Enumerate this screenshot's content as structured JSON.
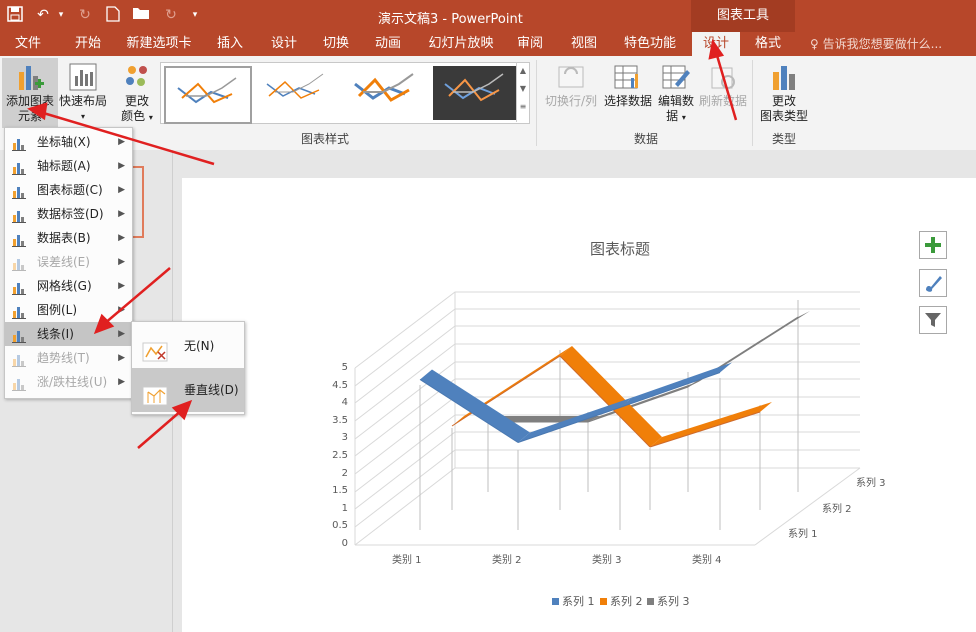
{
  "titlebar": {
    "document_title": "演示文稿3 - PowerPoint",
    "context_tab_group": "图表工具"
  },
  "tabs": [
    {
      "label": "文件"
    },
    {
      "label": "开始"
    },
    {
      "label": "新建选项卡"
    },
    {
      "label": "插入"
    },
    {
      "label": "设计"
    },
    {
      "label": "切换"
    },
    {
      "label": "动画"
    },
    {
      "label": "幻灯片放映"
    },
    {
      "label": "审阅"
    },
    {
      "label": "视图"
    },
    {
      "label": "特色功能"
    },
    {
      "label": "设计"
    },
    {
      "label": "格式"
    }
  ],
  "active_tab_index": 11,
  "tell_me": "告诉我您想要做什么...",
  "ribbon": {
    "add_element_line1": "添加图表",
    "add_element_line2": "元素",
    "quick_layout": "快速布局",
    "change_colors_line1": "更改",
    "change_colors_line2": "颜色",
    "group_chart_styles": "图表样式",
    "switch_row_col": "切换行/列",
    "select_data": "选择数据",
    "edit_data_line1": "编辑数",
    "edit_data_line2": "据",
    "refresh_data": "刷新数据",
    "group_data": "数据",
    "change_type_line1": "更改",
    "change_type_line2": "图表类型",
    "group_type": "类型"
  },
  "menu": {
    "items": [
      {
        "label": "坐标轴(X)",
        "icon": "axis-icon",
        "disabled": false,
        "submenu": true
      },
      {
        "label": "轴标题(A)",
        "icon": "axis-title-icon",
        "disabled": false,
        "submenu": true
      },
      {
        "label": "图表标题(C)",
        "icon": "chart-title-icon",
        "disabled": false,
        "submenu": true
      },
      {
        "label": "数据标签(D)",
        "icon": "data-label-icon",
        "disabled": false,
        "submenu": true
      },
      {
        "label": "数据表(B)",
        "icon": "data-table-icon",
        "disabled": false,
        "submenu": true
      },
      {
        "label": "误差线(E)",
        "icon": "error-bar-icon",
        "disabled": true,
        "submenu": true
      },
      {
        "label": "网格线(G)",
        "icon": "gridlines-icon",
        "disabled": false,
        "submenu": true
      },
      {
        "label": "图例(L)",
        "icon": "legend-icon",
        "disabled": false,
        "submenu": true
      },
      {
        "label": "线条(I)",
        "icon": "lines-icon",
        "disabled": false,
        "submenu": true,
        "hover": true
      },
      {
        "label": "趋势线(T)",
        "icon": "trendline-icon",
        "disabled": true,
        "submenu": true
      },
      {
        "label": "涨/跌柱线(U)",
        "icon": "updown-bars-icon",
        "disabled": true,
        "submenu": true
      }
    ]
  },
  "submenu": {
    "none_label": "无(N)",
    "drop_lines_label": "垂直线(D)"
  },
  "chart": {
    "title": "图表标题",
    "y_ticks": [
      "0",
      "0.5",
      "1",
      "1.5",
      "2",
      "2.5",
      "3",
      "3.5",
      "4",
      "4.5",
      "5"
    ],
    "x_ticks": [
      "类别 1",
      "类别 2",
      "类别 3",
      "类别 4"
    ],
    "z_ticks": [
      "系列 1",
      "系列 2",
      "系列 3"
    ],
    "legend": [
      "系列 1",
      "系列 2",
      "系列 3"
    ],
    "colors": {
      "s1": "#4f81bd",
      "s2": "#f07f09",
      "s3": "#7f7f7f",
      "s1_dark": "#4a78b0",
      "s2_dark": "#cd6a2c"
    }
  },
  "chart_data": {
    "type": "line",
    "title": "图表标题",
    "categories": [
      "类别 1",
      "类别 2",
      "类别 3",
      "类别 4"
    ],
    "series": [
      {
        "name": "系列 1",
        "values": [
          4.3,
          2.5,
          3.5,
          4.5
        ]
      },
      {
        "name": "系列 2",
        "values": [
          2.4,
          4.4,
          1.8,
          2.8
        ]
      },
      {
        "name": "系列 3",
        "values": [
          2.0,
          2.0,
          3.0,
          5.0
        ]
      }
    ],
    "ylim": [
      0,
      5
    ],
    "grid": true,
    "legend_position": "bottom",
    "style": "3d-line"
  }
}
